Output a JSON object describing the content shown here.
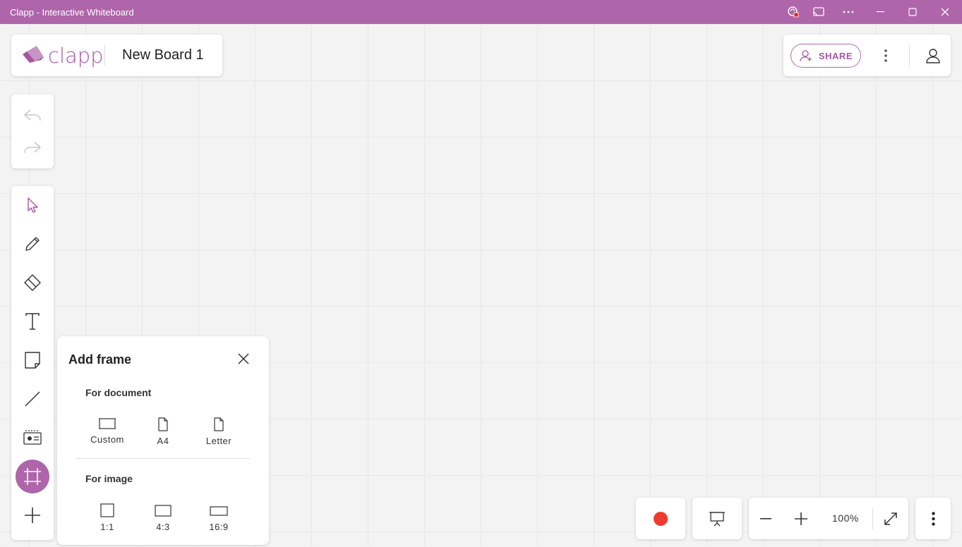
{
  "window": {
    "title": "Clapp - Interactive Whiteboard",
    "accent_color": "#ae65a9",
    "controls": [
      "extension-icon",
      "cast-icon",
      "more-icon",
      "minimize-icon",
      "maximize-icon",
      "close-icon"
    ]
  },
  "header": {
    "logo_text": "clapp",
    "board_name": "New Board 1",
    "share_label": "SHARE"
  },
  "toolbar": {
    "history": [
      "undo-icon",
      "redo-icon"
    ],
    "tools": [
      "select-icon",
      "pen-icon",
      "eraser-icon",
      "text-icon",
      "sticky-note-icon",
      "line-icon",
      "card-icon",
      "frame-icon",
      "add-icon"
    ],
    "active_tool": "frame-icon"
  },
  "add_frame_panel": {
    "title": "Add frame",
    "document_section": {
      "title": "For document",
      "options": [
        {
          "label": "Custom"
        },
        {
          "label": "A4"
        },
        {
          "label": "Letter"
        }
      ]
    },
    "image_section": {
      "title": "For image",
      "options": [
        {
          "label": "1:1"
        },
        {
          "label": "4:3"
        },
        {
          "label": "16:9"
        }
      ]
    }
  },
  "bottom_bar": {
    "record_color": "#f03a2e",
    "zoom_level": "100%"
  }
}
